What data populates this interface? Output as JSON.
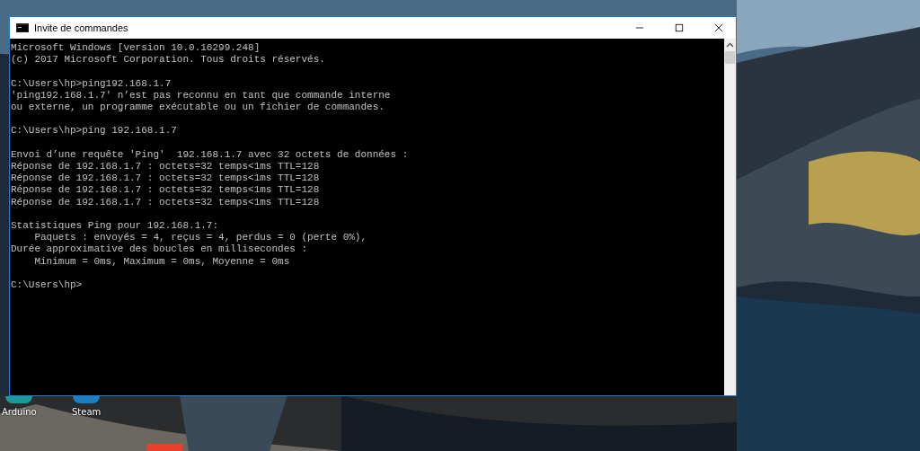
{
  "desktop": {
    "icons": [
      {
        "label": "Arduino",
        "kind": "teal"
      },
      {
        "label": "Steam",
        "kind": "blue"
      }
    ]
  },
  "window": {
    "title": "Invite de commandes",
    "console": {
      "blocks": [
        [
          "Microsoft Windows [version 10.0.16299.248]",
          "(c) 2017 Microsoft Corporation. Tous droits réservés."
        ],
        [
          "C:\\Users\\hp>ping192.168.1.7",
          "'ping192.168.1.7' n’est pas reconnu en tant que commande interne",
          "ou externe, un programme exécutable ou un fichier de commandes."
        ],
        [
          "C:\\Users\\hp>ping 192.168.1.7"
        ],
        [
          "Envoi d’une requête 'Ping'  192.168.1.7 avec 32 octets de données :",
          "Réponse de 192.168.1.7 : octets=32 temps<1ms TTL=128",
          "Réponse de 192.168.1.7 : octets=32 temps<1ms TTL=128",
          "Réponse de 192.168.1.7 : octets=32 temps<1ms TTL=128",
          "Réponse de 192.168.1.7 : octets=32 temps<1ms TTL=128"
        ],
        [
          "Statistiques Ping pour 192.168.1.7:",
          "    Paquets : envoyés = 4, reçus = 4, perdus = 0 (perte 0%),",
          "Durée approximative des boucles en millisecondes :",
          "    Minimum = 0ms, Maximum = 0ms, Moyenne = 0ms"
        ],
        [
          "C:\\Users\\hp>"
        ]
      ]
    }
  }
}
